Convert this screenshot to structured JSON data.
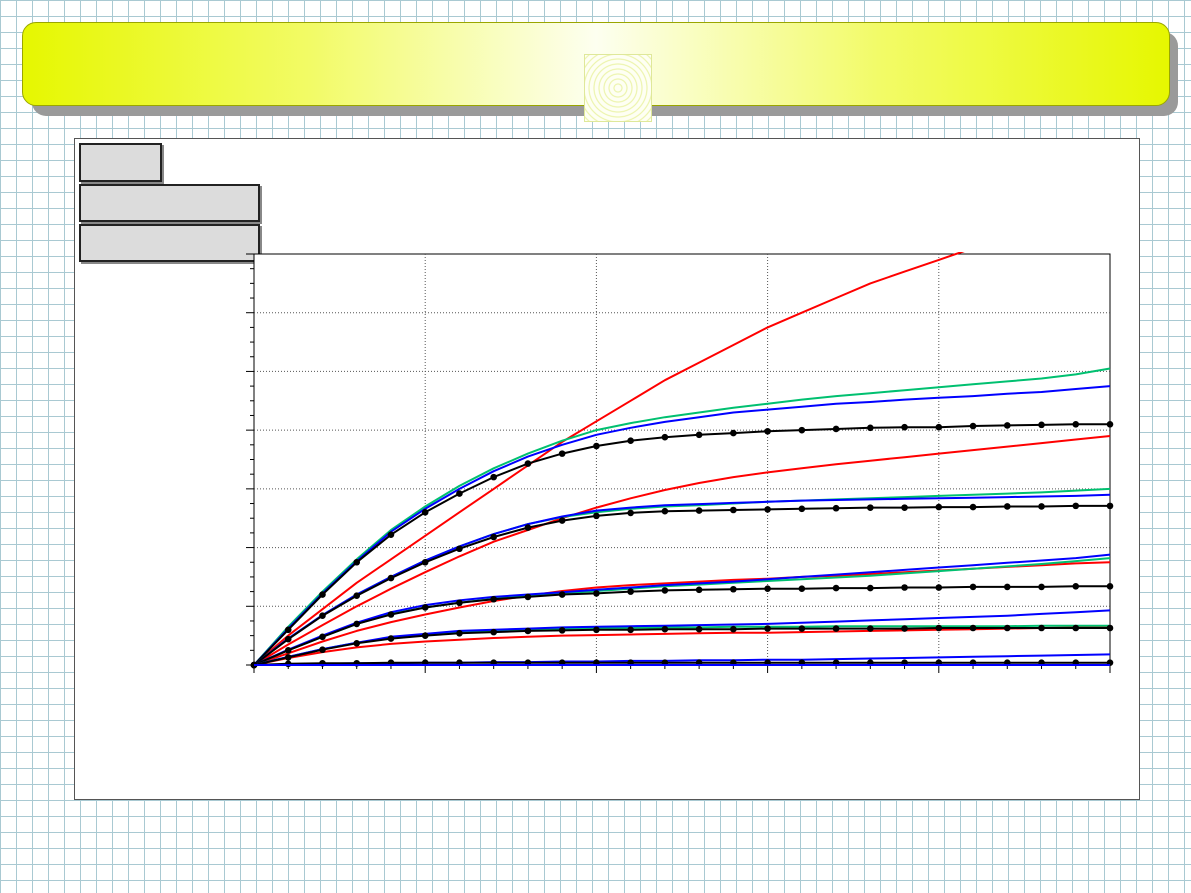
{
  "banner": {
    "title": ""
  },
  "panel": {
    "label_1": "",
    "label_2": "",
    "label_3": ""
  },
  "chart_data": {
    "type": "line",
    "title": "",
    "xlabel": "",
    "ylabel": "",
    "xlim": [
      0,
      25
    ],
    "ylim": [
      0,
      7
    ],
    "x_major_ticks": [
      0,
      5,
      10,
      15,
      20,
      25
    ],
    "y_major_ticks": [
      0,
      1,
      2,
      3,
      4,
      5,
      6,
      7
    ],
    "grid": true,
    "legend": "none",
    "colors": {
      "red": "#ff0000",
      "green": "#00c070",
      "blue": "#0000ff",
      "black": "#000000"
    },
    "x": [
      0,
      1,
      2,
      3,
      4,
      5,
      6,
      7,
      8,
      9,
      10,
      11,
      12,
      13,
      14,
      15,
      16,
      17,
      18,
      19,
      20,
      21,
      22,
      23,
      24,
      25
    ],
    "series": [
      {
        "color": "red",
        "values": [
          0,
          0.5,
          0.95,
          1.4,
          1.8,
          2.2,
          2.6,
          3.0,
          3.4,
          3.8,
          4.15,
          4.5,
          4.85,
          5.15,
          5.45,
          5.75,
          6.0,
          6.25,
          6.5,
          6.7,
          6.9,
          7.1,
          7.25,
          7.4,
          7.55,
          7.7
        ]
      },
      {
        "color": "green",
        "values": [
          0,
          0.65,
          1.25,
          1.8,
          2.3,
          2.7,
          3.05,
          3.35,
          3.6,
          3.82,
          4.0,
          4.12,
          4.22,
          4.3,
          4.38,
          4.45,
          4.52,
          4.58,
          4.63,
          4.68,
          4.73,
          4.78,
          4.83,
          4.88,
          4.95,
          5.05
        ]
      },
      {
        "color": "blue",
        "values": [
          0,
          0.62,
          1.22,
          1.77,
          2.27,
          2.66,
          3.0,
          3.3,
          3.55,
          3.75,
          3.92,
          4.04,
          4.14,
          4.22,
          4.3,
          4.35,
          4.4,
          4.45,
          4.48,
          4.52,
          4.55,
          4.58,
          4.62,
          4.65,
          4.7,
          4.75
        ]
      },
      {
        "color": "black",
        "markers": true,
        "values": [
          0,
          0.6,
          1.2,
          1.75,
          2.22,
          2.6,
          2.92,
          3.2,
          3.43,
          3.6,
          3.73,
          3.82,
          3.88,
          3.92,
          3.95,
          3.98,
          4.0,
          4.02,
          4.04,
          4.05,
          4.05,
          4.07,
          4.08,
          4.09,
          4.1,
          4.1
        ]
      },
      {
        "color": "red",
        "values": [
          0,
          0.35,
          0.68,
          1.0,
          1.3,
          1.58,
          1.85,
          2.1,
          2.3,
          2.5,
          2.68,
          2.84,
          2.98,
          3.1,
          3.2,
          3.28,
          3.35,
          3.42,
          3.48,
          3.54,
          3.6,
          3.66,
          3.72,
          3.78,
          3.84,
          3.9
        ]
      },
      {
        "color": "green",
        "values": [
          0,
          0.45,
          0.85,
          1.2,
          1.5,
          1.78,
          2.02,
          2.23,
          2.4,
          2.52,
          2.6,
          2.66,
          2.7,
          2.72,
          2.75,
          2.78,
          2.8,
          2.82,
          2.84,
          2.86,
          2.88,
          2.9,
          2.92,
          2.94,
          2.97,
          3.0
        ]
      },
      {
        "color": "blue",
        "values": [
          0,
          0.45,
          0.85,
          1.2,
          1.5,
          1.78,
          2.02,
          2.23,
          2.4,
          2.53,
          2.63,
          2.68,
          2.72,
          2.74,
          2.76,
          2.78,
          2.8,
          2.81,
          2.82,
          2.83,
          2.84,
          2.85,
          2.86,
          2.87,
          2.88,
          2.9
        ]
      },
      {
        "color": "black",
        "markers": true,
        "values": [
          0,
          0.44,
          0.84,
          1.18,
          1.48,
          1.75,
          1.98,
          2.18,
          2.34,
          2.46,
          2.54,
          2.59,
          2.62,
          2.63,
          2.64,
          2.65,
          2.66,
          2.67,
          2.68,
          2.68,
          2.69,
          2.69,
          2.7,
          2.7,
          2.71,
          2.71
        ]
      },
      {
        "color": "red",
        "values": [
          0,
          0.2,
          0.4,
          0.58,
          0.73,
          0.86,
          0.98,
          1.09,
          1.18,
          1.26,
          1.32,
          1.36,
          1.39,
          1.42,
          1.45,
          1.47,
          1.5,
          1.52,
          1.55,
          1.58,
          1.61,
          1.64,
          1.67,
          1.7,
          1.73,
          1.75
        ]
      },
      {
        "color": "green",
        "values": [
          0,
          0.25,
          0.48,
          0.7,
          0.87,
          0.98,
          1.06,
          1.13,
          1.18,
          1.22,
          1.26,
          1.3,
          1.34,
          1.37,
          1.4,
          1.43,
          1.46,
          1.49,
          1.52,
          1.56,
          1.6,
          1.64,
          1.68,
          1.72,
          1.77,
          1.82
        ]
      },
      {
        "color": "blue",
        "values": [
          0,
          0.26,
          0.5,
          0.72,
          0.9,
          1.02,
          1.1,
          1.16,
          1.2,
          1.24,
          1.28,
          1.32,
          1.36,
          1.39,
          1.42,
          1.46,
          1.5,
          1.54,
          1.58,
          1.62,
          1.66,
          1.7,
          1.74,
          1.78,
          1.82,
          1.88
        ]
      },
      {
        "color": "black",
        "markers": true,
        "values": [
          0,
          0.25,
          0.48,
          0.7,
          0.86,
          0.98,
          1.06,
          1.12,
          1.16,
          1.2,
          1.22,
          1.25,
          1.27,
          1.28,
          1.29,
          1.3,
          1.3,
          1.31,
          1.31,
          1.32,
          1.32,
          1.33,
          1.33,
          1.33,
          1.34,
          1.34
        ]
      },
      {
        "color": "red",
        "values": [
          0,
          0.12,
          0.22,
          0.3,
          0.36,
          0.4,
          0.43,
          0.46,
          0.48,
          0.5,
          0.51,
          0.52,
          0.53,
          0.54,
          0.55,
          0.55,
          0.56,
          0.57,
          0.58,
          0.59,
          0.6,
          0.61,
          0.62,
          0.63,
          0.64,
          0.65
        ]
      },
      {
        "color": "green",
        "values": [
          0,
          0.14,
          0.27,
          0.38,
          0.46,
          0.52,
          0.56,
          0.59,
          0.61,
          0.62,
          0.63,
          0.63,
          0.64,
          0.64,
          0.65,
          0.65,
          0.65,
          0.66,
          0.66,
          0.66,
          0.66,
          0.66,
          0.66,
          0.67,
          0.67,
          0.67
        ]
      },
      {
        "color": "blue",
        "values": [
          0,
          0.14,
          0.27,
          0.38,
          0.48,
          0.53,
          0.58,
          0.6,
          0.62,
          0.64,
          0.65,
          0.66,
          0.67,
          0.68,
          0.69,
          0.7,
          0.72,
          0.74,
          0.76,
          0.78,
          0.8,
          0.82,
          0.84,
          0.87,
          0.9,
          0.93
        ]
      },
      {
        "color": "black",
        "markers": true,
        "values": [
          0,
          0.13,
          0.26,
          0.37,
          0.45,
          0.5,
          0.54,
          0.56,
          0.58,
          0.59,
          0.6,
          0.6,
          0.61,
          0.61,
          0.61,
          0.62,
          0.62,
          0.62,
          0.62,
          0.62,
          0.63,
          0.63,
          0.63,
          0.63,
          0.63,
          0.63
        ]
      },
      {
        "color": "blue",
        "values": [
          0,
          0.01,
          0.02,
          0.03,
          0.03,
          0.04,
          0.04,
          0.05,
          0.05,
          0.06,
          0.06,
          0.07,
          0.07,
          0.08,
          0.08,
          0.09,
          0.09,
          0.1,
          0.11,
          0.12,
          0.13,
          0.14,
          0.15,
          0.16,
          0.17,
          0.18
        ]
      },
      {
        "color": "black",
        "markers": true,
        "values": [
          0,
          0.02,
          0.03,
          0.03,
          0.04,
          0.04,
          0.04,
          0.04,
          0.04,
          0.04,
          0.04,
          0.04,
          0.04,
          0.04,
          0.04,
          0.04,
          0.04,
          0.04,
          0.04,
          0.04,
          0.04,
          0.04,
          0.04,
          0.04,
          0.04,
          0.04
        ]
      },
      {
        "color": "blue",
        "values": [
          0,
          0,
          0,
          0,
          0,
          0,
          0,
          0,
          0,
          0,
          0,
          0,
          0,
          0,
          0,
          0,
          0,
          0,
          0,
          0,
          0,
          0,
          0,
          0,
          0,
          0
        ]
      }
    ]
  }
}
